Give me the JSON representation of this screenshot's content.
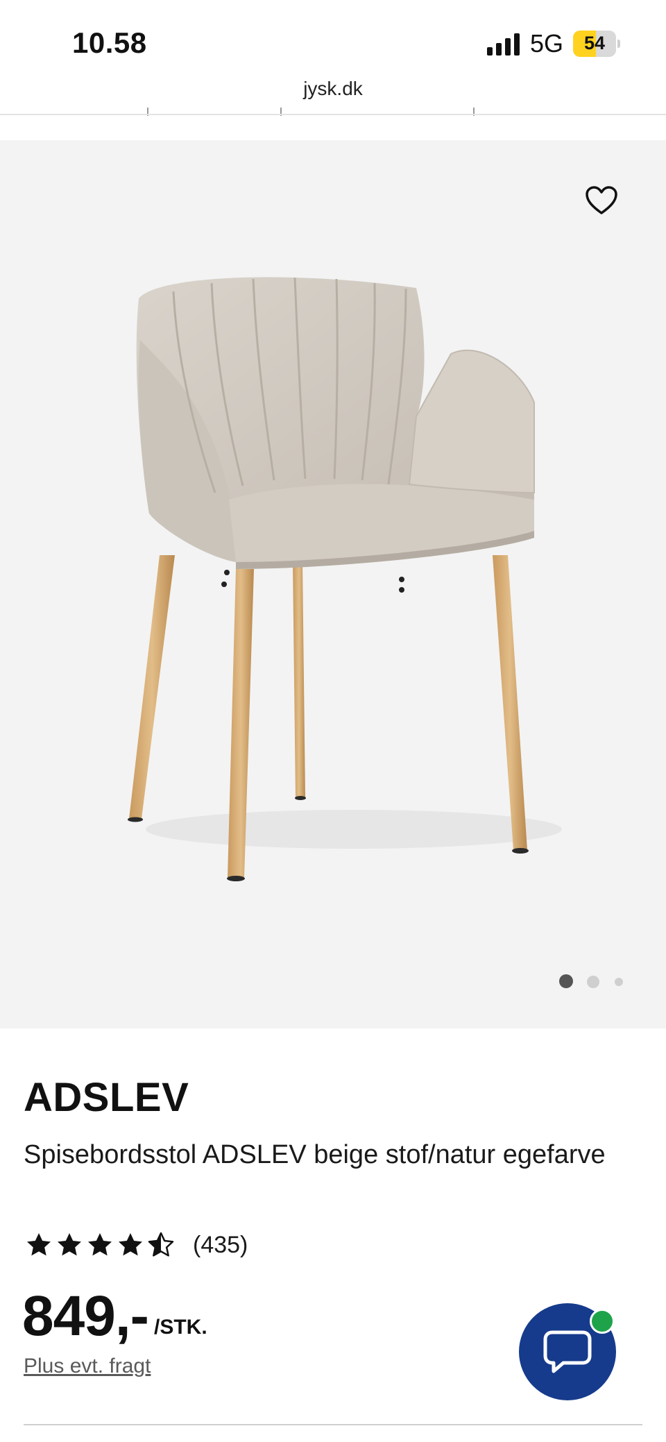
{
  "status_bar": {
    "time": "10.58",
    "network": "5G",
    "battery": "54",
    "battery_level": 0.54
  },
  "browser": {
    "url": "jysk.dk"
  },
  "gallery": {
    "image_count": 3,
    "active_index": 0,
    "favorite_icon": "heart-outline-icon"
  },
  "product": {
    "brand": "ADSLEV",
    "description": "Spisebordsstol ADSLEV beige stof/natur egefarve",
    "rating_value": 4.5,
    "rating_max": 5,
    "reviews": "(435)",
    "price": "849,-",
    "unit": "/STK.",
    "shipping_note": "Plus evt. fragt"
  },
  "chat": {
    "icon": "chat-bubble-icon",
    "online_color": "#1ea34a"
  },
  "colors": {
    "accent": "#163b8c",
    "battery": "#ffd21f",
    "gallery_bg": "#f3f3f3"
  }
}
